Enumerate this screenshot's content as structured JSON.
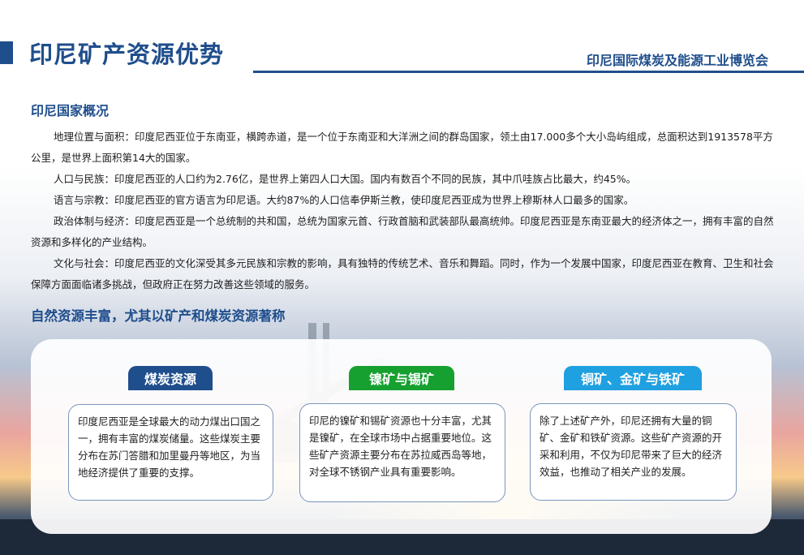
{
  "header": {
    "title": "印尼矿产资源优势",
    "expo_name": "印尼国际煤炭及能源工业博览会"
  },
  "overview": {
    "heading": "印尼国家概况",
    "paragraphs": [
      "地理位置与面积：印度尼西亚位于东南亚，横跨赤道，是一个位于东南亚和大洋洲之间的群岛国家，领土由17.000多个大小岛屿组成，总面积达到1913578平方公里，是世界上面积第14大的国家。",
      "人口与民族：印度尼西亚的人口约为2.76亿，是世界上第四人口大国。国内有数百个不同的民族，其中爪哇族占比最大，约45%。",
      "语言与宗教：印度尼西亚的官方语言为印尼语。大约87%的人口信奉伊斯兰教，使印度尼西亚成为世界上穆斯林人口最多的国家。",
      " 政治体制与经济：印度尼西亚是一个总统制的共和国，总统为国家元首、行政首脑和武装部队最高统帅。印度尼西亚是东南亚最大的经济体之一，拥有丰富的自然资源和多样化的产业结构。",
      "文化与社会：印度尼西亚的文化深受其多元民族和宗教的影响，具有独特的传统艺术、音乐和舞蹈。同时，作为一个发展中国家，印度尼西亚在教育、卫生和社会保障方面面临诸多挑战，但政府正在努力改善这些领域的服务。"
    ]
  },
  "resources": {
    "heading": "自然资源丰富，尤其以矿产和煤炭资源著称",
    "cards": [
      {
        "title": "煤炭资源",
        "title_color": "#1f4e8c",
        "text": "印度尼西亚是全球最大的动力煤出口国之一，拥有丰富的煤炭储量。这些煤炭主要分布在苏门答腊和加里曼丹等地区，为当地经济提供了重要的支撑。"
      },
      {
        "title": "镍矿与锡矿",
        "title_color": "#16a030",
        "text": "印尼的镍矿和锡矿资源也十分丰富，尤其是镍矿，在全球市场中占据重要地位。这些矿产资源主要分布在苏拉威西岛等地，对全球不锈钢产业具有重要影响。"
      },
      {
        "title": "铜矿、金矿与铁矿",
        "title_color": "#1fa0e0",
        "text": "除了上述矿产外，印尼还拥有大量的铜矿、金矿和铁矿资源。这些矿产资源的开采和利用，不仅为印尼带来了巨大的经济效益，也推动了相关产业的发展。"
      }
    ]
  }
}
